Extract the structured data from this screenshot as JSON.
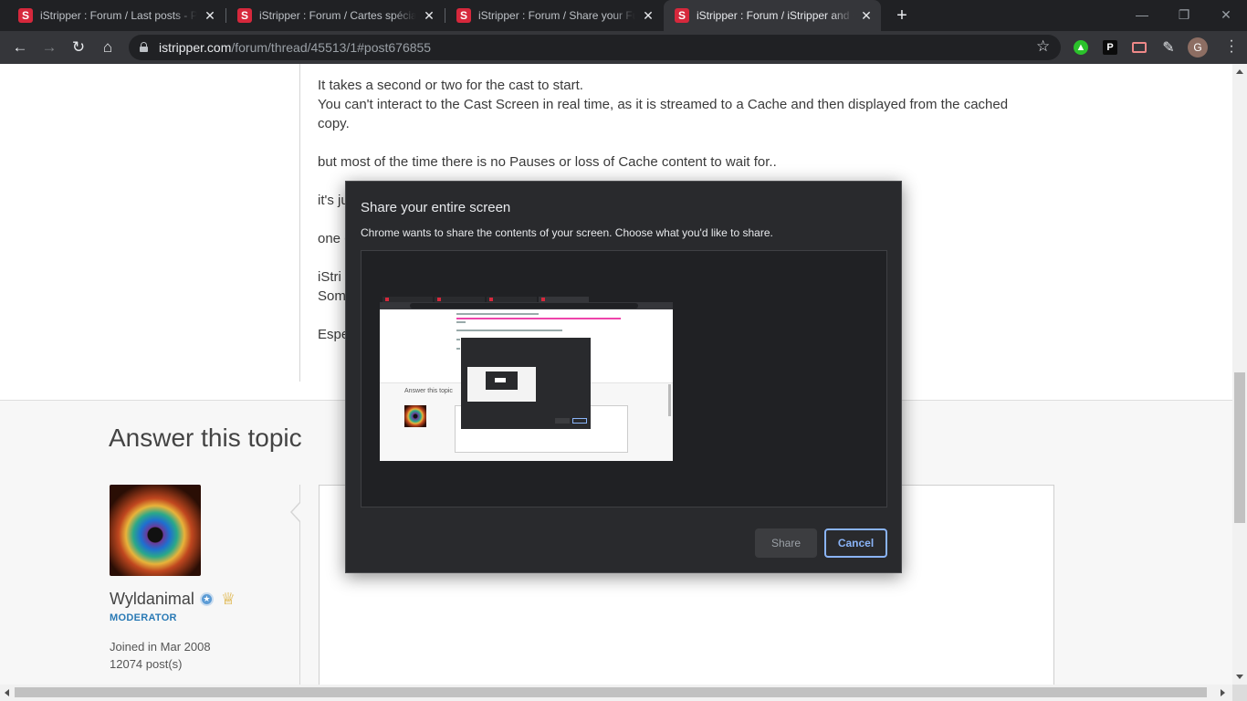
{
  "browser": {
    "tabs": [
      {
        "title": "iStripper : Forum / Last posts - Page"
      },
      {
        "title": "iStripper : Forum / Cartes spéciales"
      },
      {
        "title": "iStripper : Forum / Share your Full"
      },
      {
        "title": "iStripper : Forum / iStripper and C"
      }
    ],
    "favicon_letter": "S",
    "url_host": "istripper.com",
    "url_path": "/forum/thread/45513/1#post676855",
    "profile_initial": "G",
    "ext_p_label": "P"
  },
  "post": {
    "lines": [
      "It takes a second or two for the cast to start.",
      "You can't interact to the Cast Screen in real time, as it is streamed to a Cache and then displayed from the cached copy.",
      "",
      "but most of the time there is no Pauses or loss of Cache content to wait for..",
      "",
      "it's ju",
      "",
      "one c",
      "",
      "iStri",
      "Som",
      "",
      "Espe"
    ]
  },
  "answer": {
    "title": "Answer this topic",
    "username": "Wyldanimal",
    "role": "MODERATOR",
    "joined": "Joined in Mar 2008",
    "posts": "12074 post(s)"
  },
  "dialog": {
    "title": "Share your entire screen",
    "description": "Chrome wants to share the contents of your screen. Choose what you'd like to share.",
    "share_label": "Share",
    "cancel_label": "Cancel",
    "thumb_answer_title": "Answer this topic"
  },
  "colors": {
    "accent_blue": "#8ab4f8",
    "favicon_red": "#d6283c",
    "role_blue": "#2a7ab5"
  }
}
